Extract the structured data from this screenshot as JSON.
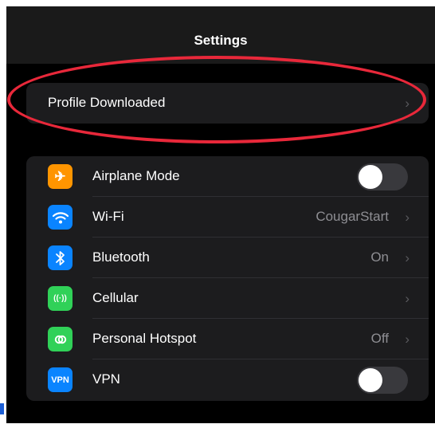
{
  "nav": {
    "title": "Settings"
  },
  "profile_row": {
    "label": "Profile Downloaded",
    "chevron": "›"
  },
  "settings": [
    {
      "label": "Airplane Mode",
      "icon": "airplane-icon",
      "glyph": "✈",
      "color": "#ff9500",
      "control": "toggle",
      "toggle_on": false
    },
    {
      "label": "Wi-Fi",
      "icon": "wifi-icon",
      "color": "#0a84ff",
      "value": "CougarStart",
      "chevron": "›"
    },
    {
      "label": "Bluetooth",
      "icon": "bluetooth-icon",
      "color": "#0a84ff",
      "value": "On",
      "chevron": "›"
    },
    {
      "label": "Cellular",
      "icon": "cellular-icon",
      "glyph": "((·))",
      "color": "#30d158",
      "chevron": "›"
    },
    {
      "label": "Personal Hotspot",
      "icon": "hotspot-icon",
      "color": "#30d158",
      "value": "Off",
      "chevron": "›"
    },
    {
      "label": "VPN",
      "icon": "vpn-icon",
      "glyph": "VPN",
      "color": "#0a84ff",
      "control": "toggle",
      "toggle_on": false
    }
  ],
  "annotation": {
    "color": "#e8283a"
  }
}
